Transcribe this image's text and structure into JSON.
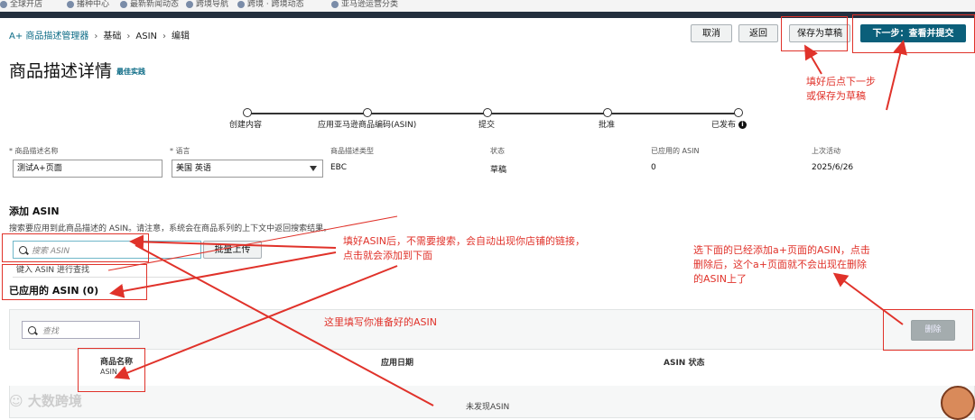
{
  "bookmarks": [
    "全球开店",
    "播种中心",
    "最新新闻动态",
    "跨境导航",
    "跨境 · 跨境动态",
    "亚马逊运营分类"
  ],
  "breadcrumb": [
    "A+ 商品描述管理器",
    "基础",
    "ASIN",
    "编辑"
  ],
  "header_buttons": {
    "cancel": "取消",
    "back": "返回",
    "save_draft": "保存为草稿",
    "next": "下一步：查看并提交"
  },
  "title": "商品描述详情",
  "best_practice": "最佳实践",
  "steps": [
    "创建内容",
    "应用亚马逊商品编码(ASIN)",
    "提交",
    "批准",
    "已发布"
  ],
  "details": {
    "name_label": "* 商品描述名称",
    "name_value": "测试A+页面",
    "lang_label": "* 语言",
    "lang_value": "美国 英语",
    "type_label": "商品描述类型",
    "type_value": "EBC",
    "status_label": "状态",
    "status_value": "草稿",
    "applied_label": "已应用的 ASIN",
    "applied_value": "0",
    "last_label": "上次活动",
    "last_value": "2025/6/26"
  },
  "add_asin": {
    "heading": "添加 ASIN",
    "hint": "搜索要应用到此商品描述的 ASIN。请注意，系统会在商品系列的上下文中返回搜索结果。",
    "search_placeholder": "搜索 ASIN",
    "bulk_upload": "批量上传",
    "type_hint": "键入 ASIN 进行查找"
  },
  "applied": {
    "heading": "已应用的 ASIN (0)",
    "filter_placeholder": "查找",
    "delete": "删除",
    "col_name": "商品名称",
    "col_name_sub": "ASIN",
    "col_date": "应用日期",
    "col_status": "ASIN 状态",
    "empty": "未发现ASIN"
  },
  "annotations": {
    "note_next": [
      "填好后点下一步",
      "或保存为草稿"
    ],
    "note_asin": [
      "填好ASIN后，不需要搜索，会自动出现你店铺的链接，",
      "点击就会添加到下面"
    ],
    "note_fill": "这里填写你准备好的ASIN",
    "note_delete": [
      "选下面的已经添加a+页面的ASIN，点击",
      "删除后，这个a+页面就不会出现在删除",
      "的ASIN上了"
    ]
  },
  "watermark": "大数跨境",
  "colors": {
    "primary": "#0b5f7a",
    "annotation": "#e0322a",
    "link": "#0a6a85"
  }
}
